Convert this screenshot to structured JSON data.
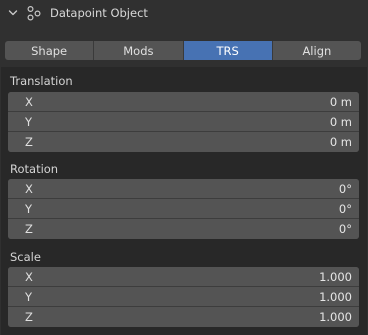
{
  "panel": {
    "title": "Datapoint Object",
    "expand_icon": "chevron-down-icon",
    "object_icon": "object-data-icon"
  },
  "tabs": [
    {
      "label": "Shape",
      "active": false
    },
    {
      "label": "Mods",
      "active": false
    },
    {
      "label": "TRS",
      "active": true
    },
    {
      "label": "Align",
      "active": false
    }
  ],
  "translation": {
    "label": "Translation",
    "x": {
      "axis": "X",
      "value": "0 m"
    },
    "y": {
      "axis": "Y",
      "value": "0 m"
    },
    "z": {
      "axis": "Z",
      "value": "0 m"
    }
  },
  "rotation": {
    "label": "Rotation",
    "x": {
      "axis": "X",
      "value": "0°"
    },
    "y": {
      "axis": "Y",
      "value": "0°"
    },
    "z": {
      "axis": "Z",
      "value": "0°"
    }
  },
  "scale": {
    "label": "Scale",
    "x": {
      "axis": "X",
      "value": "1.000"
    },
    "y": {
      "axis": "Y",
      "value": "1.000"
    },
    "z": {
      "axis": "Z",
      "value": "1.000"
    }
  },
  "colors": {
    "accent": "#4772b3",
    "field": "#545454",
    "background": "#282828"
  }
}
